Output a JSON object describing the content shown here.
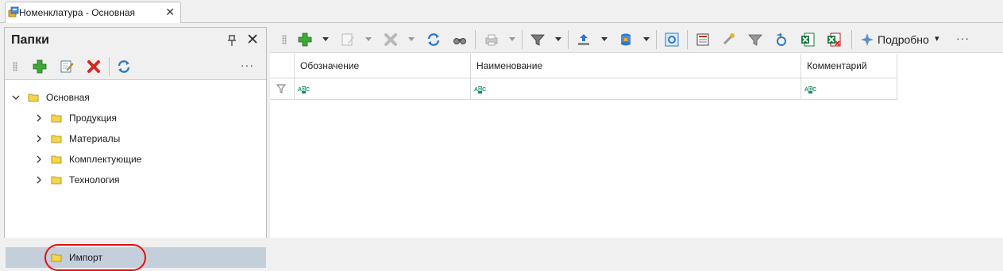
{
  "window": {
    "tab_title": "Номенклатура - Основная",
    "close_glyph": "✕"
  },
  "folders_panel": {
    "title": "Папки",
    "close_glyph": "✕",
    "more_glyph": "···",
    "toolbar": [
      "add-icon",
      "edit-icon",
      "delete-icon",
      "refresh-icon"
    ],
    "tree": [
      {
        "label": "Основная",
        "expanded": true,
        "level": 0
      },
      {
        "label": "Продукция",
        "expanded": false,
        "level": 1
      },
      {
        "label": "Материалы",
        "expanded": false,
        "level": 1
      },
      {
        "label": "Комплектующие",
        "expanded": false,
        "level": 1
      },
      {
        "label": "Технология",
        "expanded": false,
        "level": 1
      },
      {
        "label": "Импорт",
        "expanded": false,
        "level": 1,
        "selected": true,
        "highlighted": true
      }
    ]
  },
  "grid_toolbar": {
    "details_label": "Подробно",
    "details_arrow": "▾",
    "more_glyph": "···"
  },
  "grid": {
    "columns": [
      "Обозначение",
      "Наименование",
      "Комментарий"
    ],
    "filter_row_badges": [
      "ABC",
      "ABC",
      "ABC"
    ]
  },
  "colors": {
    "selection": "#c5cfdb",
    "highlight_ring": "#e10f0f",
    "filter_badge": "#1a8f5e"
  }
}
